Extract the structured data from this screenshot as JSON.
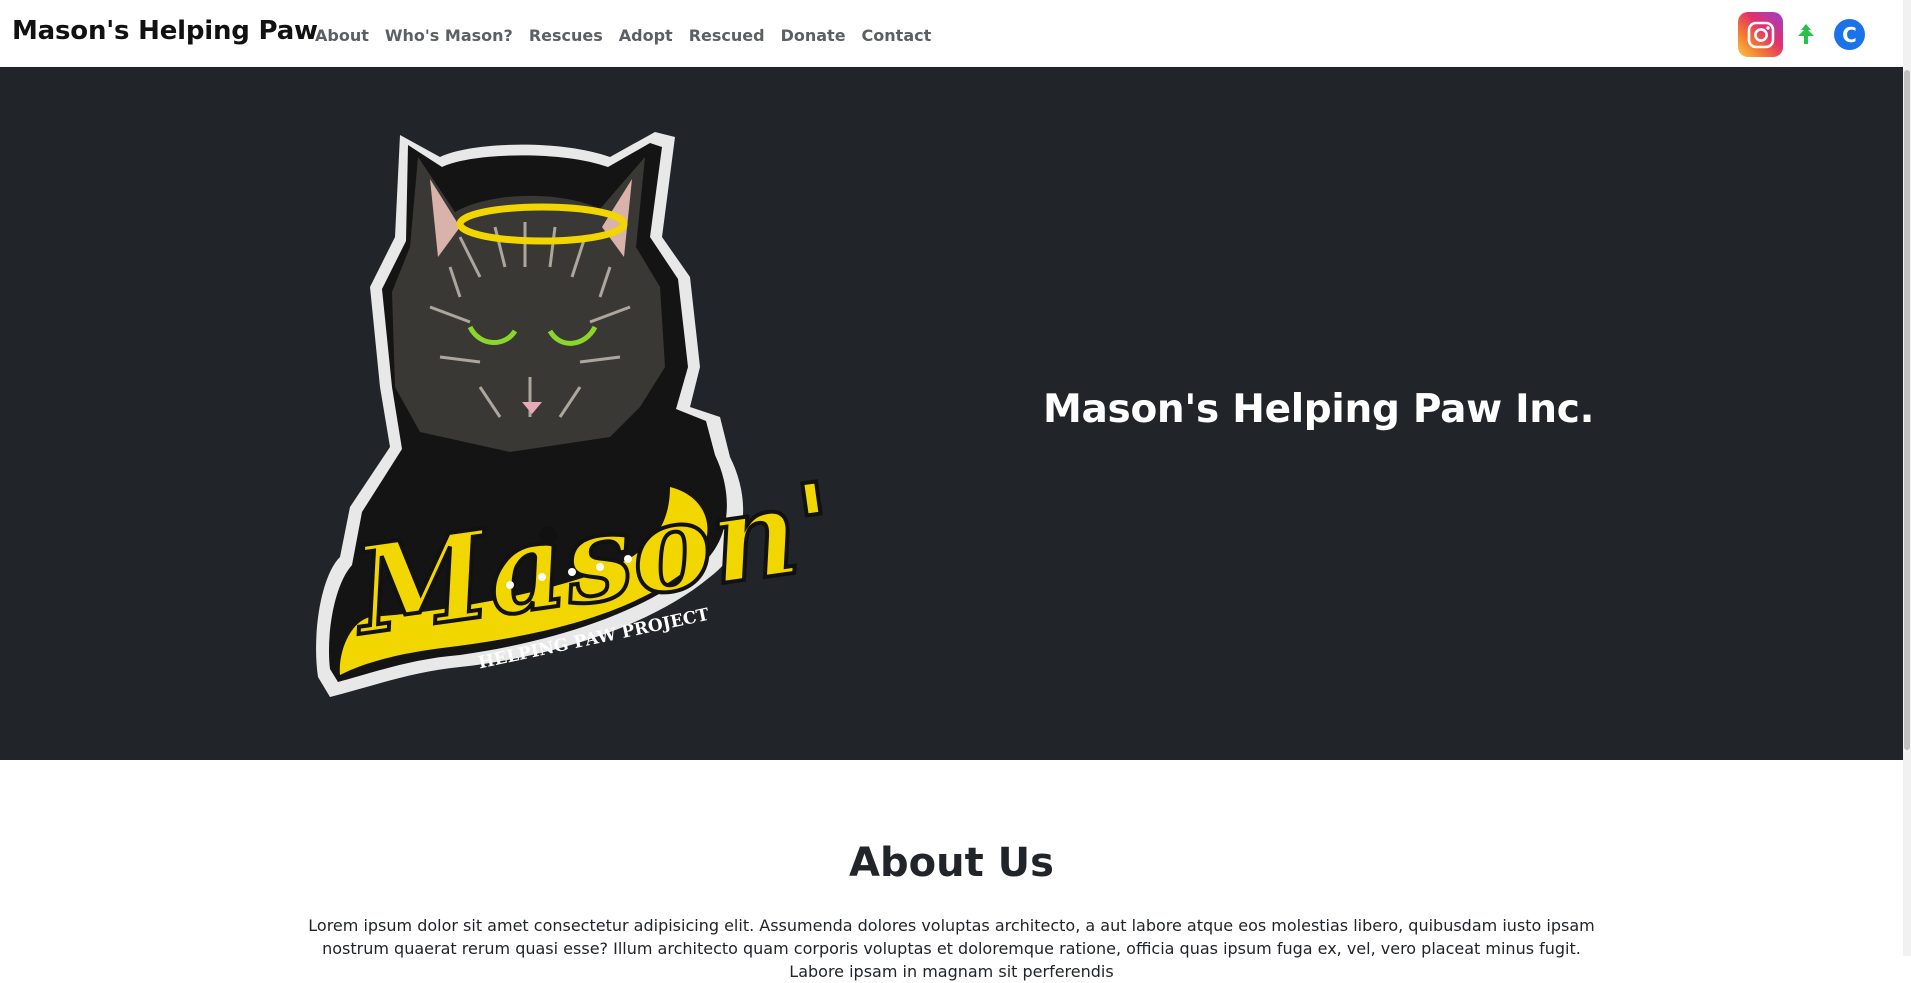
{
  "navbar": {
    "brand": "Mason's Helping Paw",
    "links": [
      "About",
      "Who's Mason?",
      "Rescues",
      "Adopt",
      "Rescued",
      "Donate",
      "Contact"
    ],
    "social": [
      "instagram-icon",
      "linktree-icon",
      "c-icon"
    ]
  },
  "hero": {
    "title": "Mason's Helping Paw Inc.",
    "logo": {
      "main": "Mason's",
      "sub": "HELPING PAW PROJECT"
    }
  },
  "about": {
    "title": "About Us",
    "text": "Lorem ipsum dolor sit amet consectetur adipisicing elit. Assumenda dolores voluptas architecto, a aut labore atque eos molestias libero, quibusdam iusto ipsam nostrum quaerat rerum quasi esse? Illum architecto quam corporis voluptas et doloremque ratione, officia quas ipsum fuga ex, vel, vero placeat minus fugit. Labore ipsam in magnam sit perferendis"
  },
  "colors": {
    "hero_bg": "#212529",
    "logo_yellow": "#f2d600",
    "nav_link": "#5c5f63"
  }
}
